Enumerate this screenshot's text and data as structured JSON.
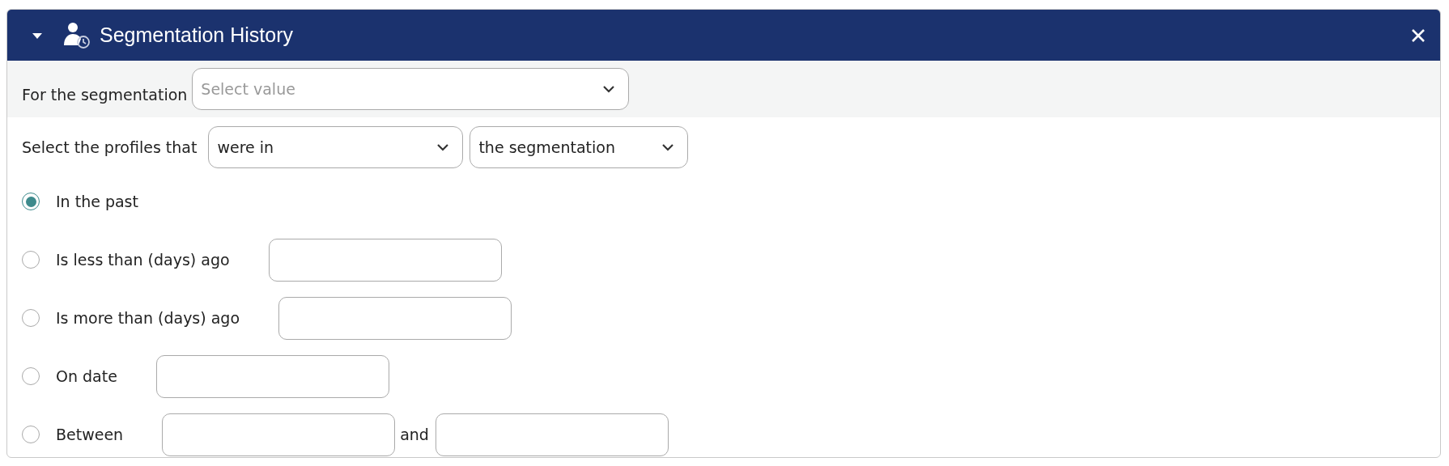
{
  "panel": {
    "title": "Segmentation History",
    "expanded": true
  },
  "segmentation": {
    "label": "For the segmentation",
    "placeholder": "Select value"
  },
  "profiles": {
    "label": "Select the profiles that",
    "condition": "were in",
    "target": "the segmentation"
  },
  "options": [
    {
      "label": "In the past",
      "selected": true,
      "kind": "plain"
    },
    {
      "label": "Is less than (days) ago",
      "selected": false,
      "kind": "single"
    },
    {
      "label": "Is more than (days) ago",
      "selected": false,
      "kind": "single"
    },
    {
      "label": "On date",
      "selected": false,
      "kind": "single"
    },
    {
      "label": "Between",
      "selected": false,
      "kind": "range",
      "joiner": "and"
    }
  ]
}
